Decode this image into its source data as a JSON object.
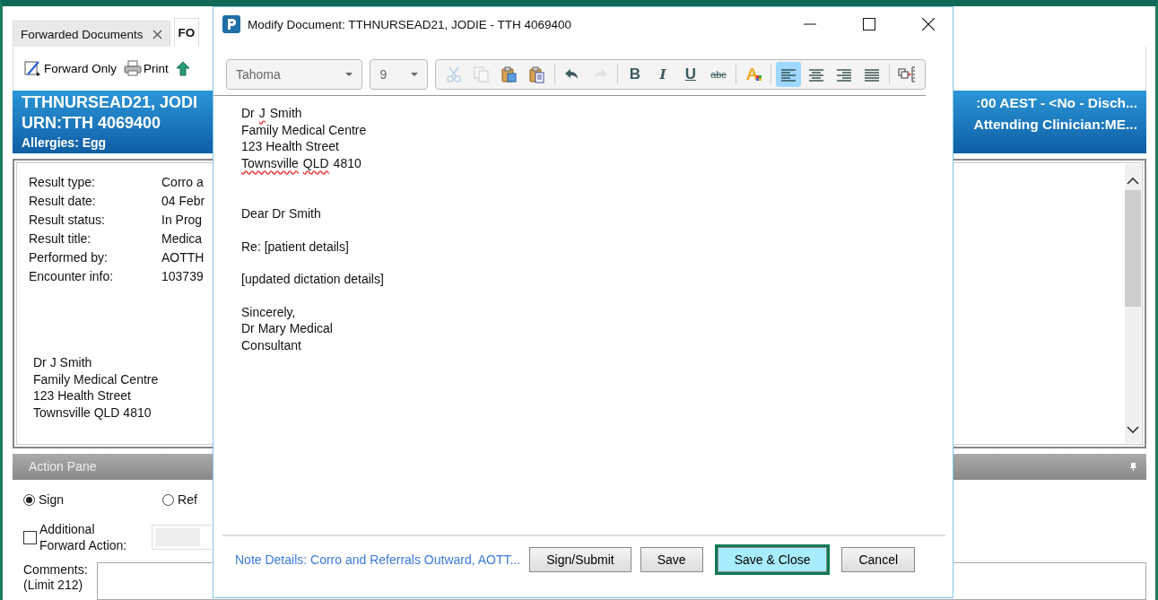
{
  "app": {
    "tabs": [
      {
        "label": "Forwarded Documents",
        "closable": true,
        "selected": false
      },
      {
        "label": "FO",
        "closable": false,
        "selected": true
      }
    ],
    "toolbar": [
      {
        "kind": "forward",
        "label": "Forward Only"
      },
      {
        "kind": "print",
        "label": "Print"
      },
      {
        "kind": "up"
      }
    ],
    "banner": {
      "name": "TTHNURSEAD21, JODI",
      "urn": "URN:TTH 4069400",
      "allergies": "Allergies: Egg",
      "right_1": ":00 AEST - <No - Disch...",
      "right_2": "Attending Clinician:ME..."
    },
    "result_fields": [
      {
        "label": "Result type:",
        "value": "Corro a"
      },
      {
        "label": "Result date:",
        "value": "04 Febr"
      },
      {
        "label": "Result status:",
        "value": "In Prog"
      },
      {
        "label": "Result title:",
        "value": "Medica"
      },
      {
        "label": "Performed by:",
        "value": "AOTTH"
      },
      {
        "label": "Encounter info:",
        "value": "103739"
      }
    ],
    "result_address": [
      "Dr J Smith",
      "Family Medical Centre",
      "123 Health Street",
      "Townsville QLD 4810"
    ],
    "action_pane": {
      "title": "Action Pane",
      "radios": [
        {
          "label": "Sign",
          "selected": true
        },
        {
          "label": "Ref",
          "selected": false
        }
      ],
      "additional": {
        "label": "Additional Forward Action:",
        "checked": false
      },
      "comments_label": "Comments:",
      "comments_limit": "(Limit 212)"
    }
  },
  "dialog": {
    "title": "Modify Document: TTHNURSEAD21, JODIE - TTH 4069400",
    "font": "Tahoma",
    "size": "9",
    "tools": [
      {
        "kind": "cut",
        "disabled": true,
        "selected": false
      },
      {
        "kind": "copy",
        "disabled": true,
        "selected": false
      },
      {
        "kind": "paste",
        "disabled": false,
        "selected": false
      },
      {
        "kind": "paste-special",
        "disabled": false,
        "selected": false
      },
      {
        "kind": "sep"
      },
      {
        "kind": "undo",
        "disabled": false,
        "selected": false
      },
      {
        "kind": "redo",
        "disabled": true,
        "selected": false
      },
      {
        "kind": "sep"
      },
      {
        "kind": "bold",
        "label": "B",
        "disabled": false,
        "selected": false
      },
      {
        "kind": "italic",
        "label": "I",
        "disabled": false,
        "selected": false
      },
      {
        "kind": "underline",
        "label": "U",
        "disabled": false,
        "selected": false
      },
      {
        "kind": "strike",
        "label": "abc",
        "disabled": false,
        "selected": false
      },
      {
        "kind": "sep"
      },
      {
        "kind": "font-color",
        "disabled": false,
        "selected": false
      },
      {
        "kind": "sep"
      },
      {
        "kind": "align-left",
        "disabled": false,
        "selected": true
      },
      {
        "kind": "align-center",
        "disabled": false,
        "selected": false
      },
      {
        "kind": "align-right",
        "disabled": false,
        "selected": false
      },
      {
        "kind": "justify",
        "disabled": false,
        "selected": false
      },
      {
        "kind": "sep"
      },
      {
        "kind": "insert",
        "disabled": false,
        "selected": false
      }
    ],
    "paragraphs": [
      [
        {
          "segments": [
            {
              "text": "Dr",
              "flagged": false
            },
            {
              "text": "J",
              "flagged": true
            },
            {
              "text": "Smith",
              "flagged": false
            }
          ]
        },
        {
          "text": "Family Medical Centre"
        },
        {
          "text": "123 Health Street"
        },
        {
          "segments": [
            {
              "text": "Townsville",
              "flagged": true
            },
            {
              "text": "QLD",
              "flagged": true
            },
            {
              "text": "4810",
              "flagged": false
            }
          ]
        }
      ],
      [
        {
          "text": "Dear Dr Smith"
        }
      ],
      [
        {
          "text": "Re: [patient details]"
        }
      ],
      [
        {
          "text": "[updated dictation details]"
        }
      ],
      [
        {
          "text": "Sincerely,"
        },
        {
          "text": "Dr Mary Medical"
        },
        {
          "text": "Consultant"
        }
      ]
    ],
    "note_details": "Note Details: Corro and Referrals Outward, AOTT...",
    "buttons": [
      {
        "label": "Sign/Submit",
        "default": false
      },
      {
        "label": "Save",
        "default": false
      },
      {
        "label": "Save & Close",
        "default": true
      },
      {
        "label": "Cancel",
        "default": false
      }
    ]
  }
}
